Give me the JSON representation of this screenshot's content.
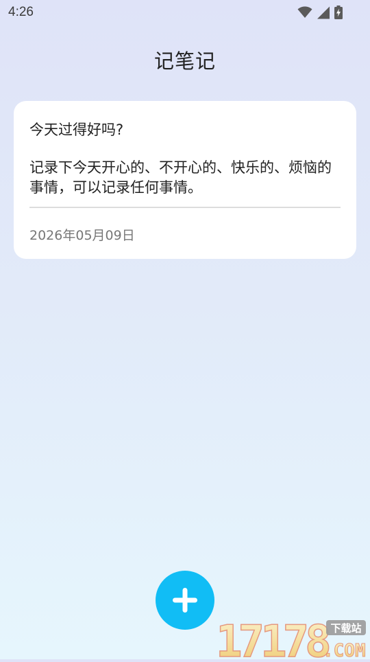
{
  "status_bar": {
    "time": "4:26",
    "icons": [
      "wifi-icon",
      "signal-icon",
      "battery-charging-icon"
    ]
  },
  "header": {
    "title": "记笔记"
  },
  "notes": [
    {
      "title": "今天过得好吗?",
      "body": "记录下今天开心的、不开心的、快乐的、烦恼的事情，可以记录任何事情。",
      "date": "2026年05月09日"
    }
  ],
  "fab": {
    "icon": "plus-icon",
    "color": "#11bdf5"
  },
  "watermark": {
    "text": "17178",
    "badge": "下载站",
    "suffix": ".COM"
  },
  "colors": {
    "accent": "#11bdf5",
    "card": "#ffffff",
    "date_text": "#777777"
  }
}
